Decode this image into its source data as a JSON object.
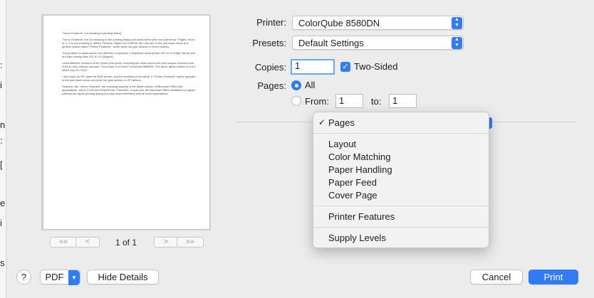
{
  "sliver_chars": [
    ":",
    "i",
    "n",
    ":",
    "[",
    "e",
    "i",
    "s"
  ],
  "preview": {
    "paragraphs": [
      "\"Xerox Features\" not showing in printing dialog",
      "\"Xerox Features\" are not showing in the printing dialog pull-down menu (the one just below \"Pages: From: to:\"). It is not showing in Safari, Preview, Pages nor TextEdit. All I can see in the pull-down menu is a generic option called \"Printer Features\", which does not give access to Xerox options.",
      "The problem is observed on two different computers: a MacBook running Mac OS 10.13 (High Sierra) and an iMac running Mac OS 10.14 (Mojave).",
      "I tried different versions of the Xerox print driver, including the most recent one and various versions from 2015 to now, without success. The printer is a Xerox ColorQube 8580DN. The driver latest version is 5.6.0, dated July 20, 2020.",
      "I also have an HP LaserJet 3052 printer, and the problem is the same: a \"Printer Features\" option appears in the pull-down menu and does not give access to HP options.",
      "However, the \"Xerox Features\" are showing properly in the latest version of Microsoft Office 365 applications: Word, Excel and PowerPoint. Therefore, it looks like the Microsoft Office installation program patches the Apple printing dialog in a way which interferes with all other applications."
    ],
    "first_label": "««",
    "prev_label": "<",
    "page_indicator": "1 of 1",
    "next_label": ">",
    "last_label": "»»"
  },
  "form": {
    "printer_label": "Printer:",
    "printer_value": "ColorQube 8580DN",
    "presets_label": "Presets:",
    "presets_value": "Default Settings",
    "copies_label": "Copies:",
    "copies_value": "1",
    "two_sided_label": "Two-Sided",
    "pages_label": "Pages:",
    "all_label": "All",
    "from_label": "From:",
    "from_value": "1",
    "to_label": "to:",
    "to_value": "1"
  },
  "menu": {
    "checkmark": "✓",
    "items": [
      "Pages",
      "Layout",
      "Color Matching",
      "Paper Handling",
      "Paper Feed",
      "Cover Page",
      "Printer Features",
      "Supply Levels"
    ]
  },
  "bottom": {
    "help_label": "?",
    "pdf_label": "PDF",
    "hide_details_label": "Hide Details",
    "cancel_label": "Cancel",
    "print_label": "Print"
  },
  "colors": {
    "accent": "#2f7cf6",
    "background": "#ececec"
  }
}
